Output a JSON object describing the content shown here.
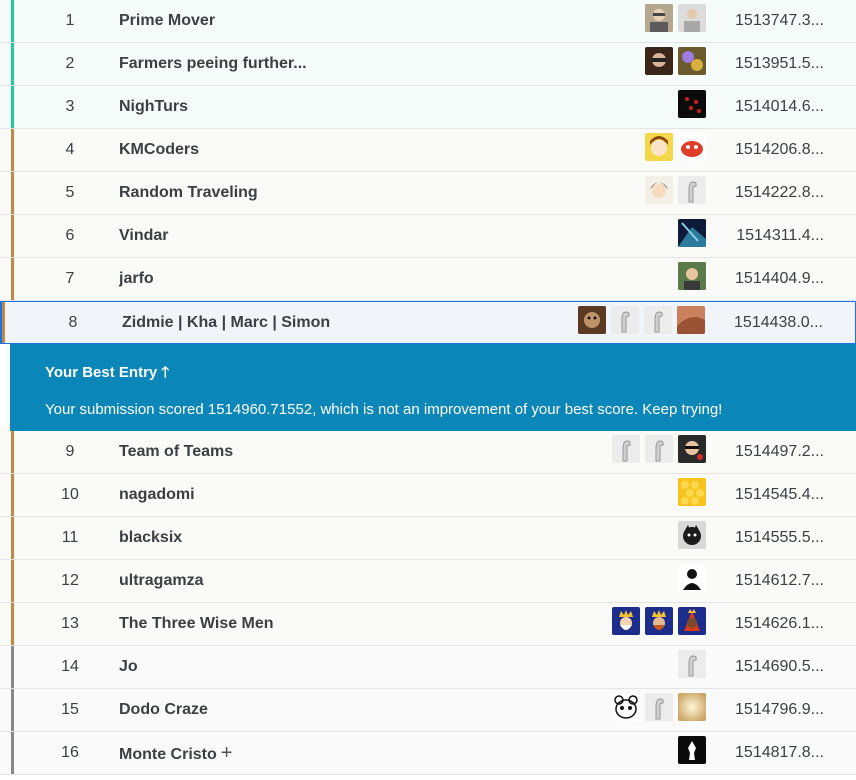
{
  "best_entry": {
    "title": "Your Best Entry",
    "arrow": "🡑",
    "message": "Your submission scored 1514960.71552, which is not an improvement of your best score. Keep trying!"
  },
  "colors": {
    "gold_bar": "#20c997",
    "silver_bar": "#c08a3e",
    "bronze_bar": "#888888",
    "highlight": "#0a86b8",
    "dot_orange": "#f4731c",
    "dot_teal": "#20beff",
    "dot_purple": "#8f50a0",
    "dot_gold": "#f2a900"
  },
  "rows": [
    {
      "rank": "1",
      "team": "Prime Mover",
      "score": "1513747.3...",
      "avatars": [
        "photo-man-glasses",
        "photo-man-gray"
      ],
      "bar": "gold"
    },
    {
      "rank": "2",
      "team": "Farmers peeing further...",
      "score": "1513951.5...",
      "avatars": [
        "photo-glasses-dark",
        "colorful-art"
      ],
      "bar": "gold"
    },
    {
      "rank": "3",
      "team": "NighTurs",
      "score": "1514014.6...",
      "avatars": [
        "dark-red-pattern"
      ],
      "bar": "gold"
    },
    {
      "rank": "4",
      "team": "KMCoders",
      "score": "1514206.8...",
      "avatars": [
        "anime-girl",
        "red-crab"
      ],
      "bar": "silver"
    },
    {
      "rank": "5",
      "team": "Random Traveling",
      "score": "1514222.8...",
      "avatars": [
        "anime-dark-hair",
        "default-goose"
      ],
      "bar": "silver"
    },
    {
      "rank": "6",
      "team": "Vindar",
      "score": "1514311.4...",
      "avatars": [
        "blue-abstract"
      ],
      "bar": "silver"
    },
    {
      "rank": "7",
      "team": "jarfo",
      "score": "1514404.9...",
      "avatars": [
        "photo-man-outdoor"
      ],
      "bar": "silver"
    },
    {
      "rank": "8",
      "team": "Zidmie | Kha | Marc | Simon",
      "score": "1514438.0...",
      "avatars": [
        "photo-brown",
        "default-goose",
        "default-goose",
        "photo-orange"
      ],
      "bar": "silver",
      "current": true
    },
    {
      "rank": "9",
      "team": "Team of Teams",
      "score": "1514497.2...",
      "avatars": [
        "default-goose",
        "default-goose",
        "photo-man-red"
      ],
      "bar": "silver"
    },
    {
      "rank": "10",
      "team": "nagadomi",
      "score": "1514545.4...",
      "avatars": [
        "honeycomb"
      ],
      "bar": "silver"
    },
    {
      "rank": "11",
      "team": "blacksix",
      "score": "1514555.5...",
      "avatars": [
        "black-cat"
      ],
      "bar": "silver"
    },
    {
      "rank": "12",
      "team": "ultragamza",
      "score": "1514612.7...",
      "avatars": [
        "silhouette"
      ],
      "bar": "silver"
    },
    {
      "rank": "13",
      "team": "The Three Wise Men",
      "score": "1514626.1...",
      "avatars": [
        "wise-king-1",
        "wise-king-2",
        "wise-king-3"
      ],
      "bar": "silver"
    },
    {
      "rank": "14",
      "team": "Jo",
      "score": "1514690.5...",
      "avatars": [
        "default-goose"
      ],
      "bar": "bronze"
    },
    {
      "rank": "15",
      "team": "Dodo Craze",
      "score": "1514796.9...",
      "avatars": [
        "bear-face",
        "default-goose",
        "gold-blur"
      ],
      "bar": "bronze"
    },
    {
      "rank": "16",
      "team": "Monte Cristo",
      "score": "1514817.8...",
      "avatars": [
        "chess-piece"
      ],
      "bar": "bronze",
      "plus": "+"
    }
  ]
}
